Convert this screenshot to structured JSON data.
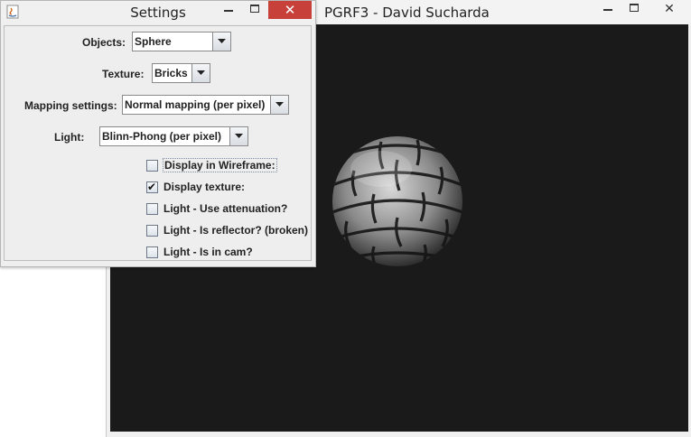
{
  "main_window": {
    "title": "PGRF3 - David Sucharda",
    "close_glyph": "✕"
  },
  "settings": {
    "title": "Settings",
    "close_glyph": "✕",
    "objects": {
      "label": "Objects:",
      "value": "Sphere"
    },
    "texture": {
      "label": "Texture:",
      "value": "Bricks"
    },
    "mapping": {
      "label": "Mapping settings:",
      "value": "Normal mapping (per pixel)"
    },
    "light": {
      "label": "Light:",
      "value": "Blinn-Phong (per pixel)"
    },
    "checkboxes": [
      {
        "label": "Display in Wireframe:",
        "checked": false
      },
      {
        "label": "Display texture:",
        "checked": true
      },
      {
        "label": "Light - Use attenuation?",
        "checked": false
      },
      {
        "label": "Light - Is reflector? (broken)",
        "checked": false
      },
      {
        "label": "Light - Is in cam?",
        "checked": false
      }
    ],
    "check_glyph": "✔"
  },
  "colors": {
    "viewport_bg": "#1a1a1a",
    "close_button": "#c7403a"
  }
}
